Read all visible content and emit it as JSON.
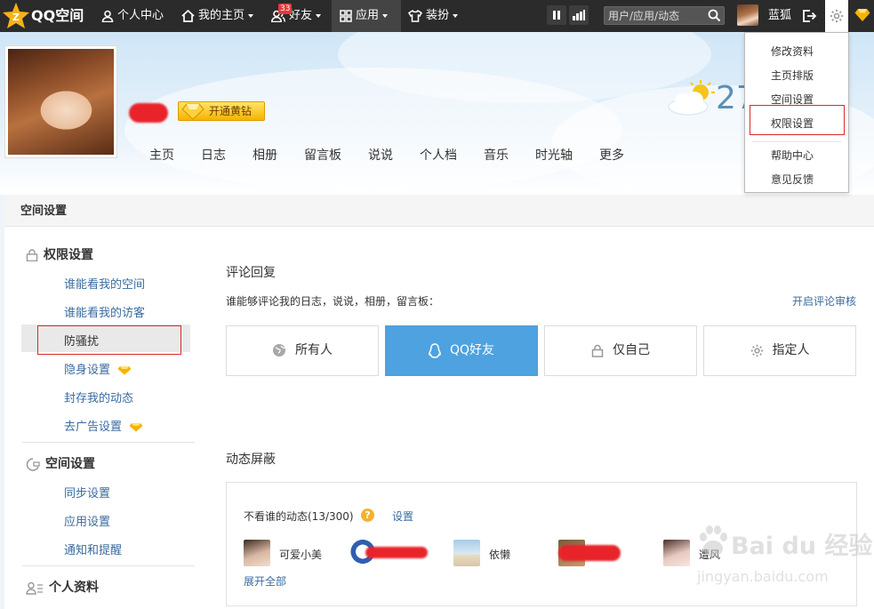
{
  "topbar": {
    "logo_text": "QQ空间",
    "items": [
      {
        "label": "个人中心",
        "icon": "user-icon"
      },
      {
        "label": "我的主页",
        "icon": "home-icon"
      },
      {
        "label": "好友",
        "icon": "friends-icon",
        "badge": "33"
      },
      {
        "label": "应用",
        "icon": "apps-grid-icon"
      },
      {
        "label": "装扮",
        "icon": "shirt-icon"
      }
    ],
    "search_placeholder": "用户/应用/动态",
    "username": "蓝狐",
    "bar_color": "#2b2b2b"
  },
  "header": {
    "vip_label": "开通黄钻",
    "temperature": "27",
    "tabs": [
      "主页",
      "日志",
      "相册",
      "留言板",
      "说说",
      "个人档",
      "音乐",
      "时光轴",
      "更多"
    ]
  },
  "dropdown": {
    "items": [
      "修改资料",
      "主页排版",
      "空间设置",
      "权限设置",
      "帮助中心",
      "意见反馈"
    ],
    "highlighted": "权限设置"
  },
  "settings": {
    "header_title": "空间设置",
    "sidebar": {
      "groups": [
        {
          "title": "权限设置",
          "icon": "lock-icon",
          "items": [
            "谁能看我的空间",
            "谁能看我的访客",
            "防骚扰",
            "隐身设置",
            "封存我的动态",
            "去广告设置"
          ]
        },
        {
          "title": "空间设置",
          "icon": "space-settings-icon",
          "items": [
            "同步设置",
            "应用设置",
            "通知和提醒"
          ]
        },
        {
          "title": "个人资料",
          "icon": "profile-icon",
          "items": []
        }
      ],
      "active_item": "防骚扰"
    },
    "comment": {
      "title": "评论回复",
      "description": "谁能够评论我的日志，说说，相册，留言板：",
      "review_link": "开启评论审核",
      "options": [
        "所有人",
        "QQ好友",
        "仅自己",
        "指定人"
      ],
      "selected": "QQ好友",
      "accent_color": "#4ea2e0"
    },
    "mute": {
      "title": "动态屏蔽",
      "label": "不看谁的动态(13/300)",
      "settings_link": "设置",
      "friends": [
        "可爱小美",
        "依懒",
        "遭风"
      ],
      "expand_link": "展开全部"
    }
  },
  "watermark": {
    "brand": "Bai du 经验",
    "url": "jingyan.baidu.com"
  }
}
